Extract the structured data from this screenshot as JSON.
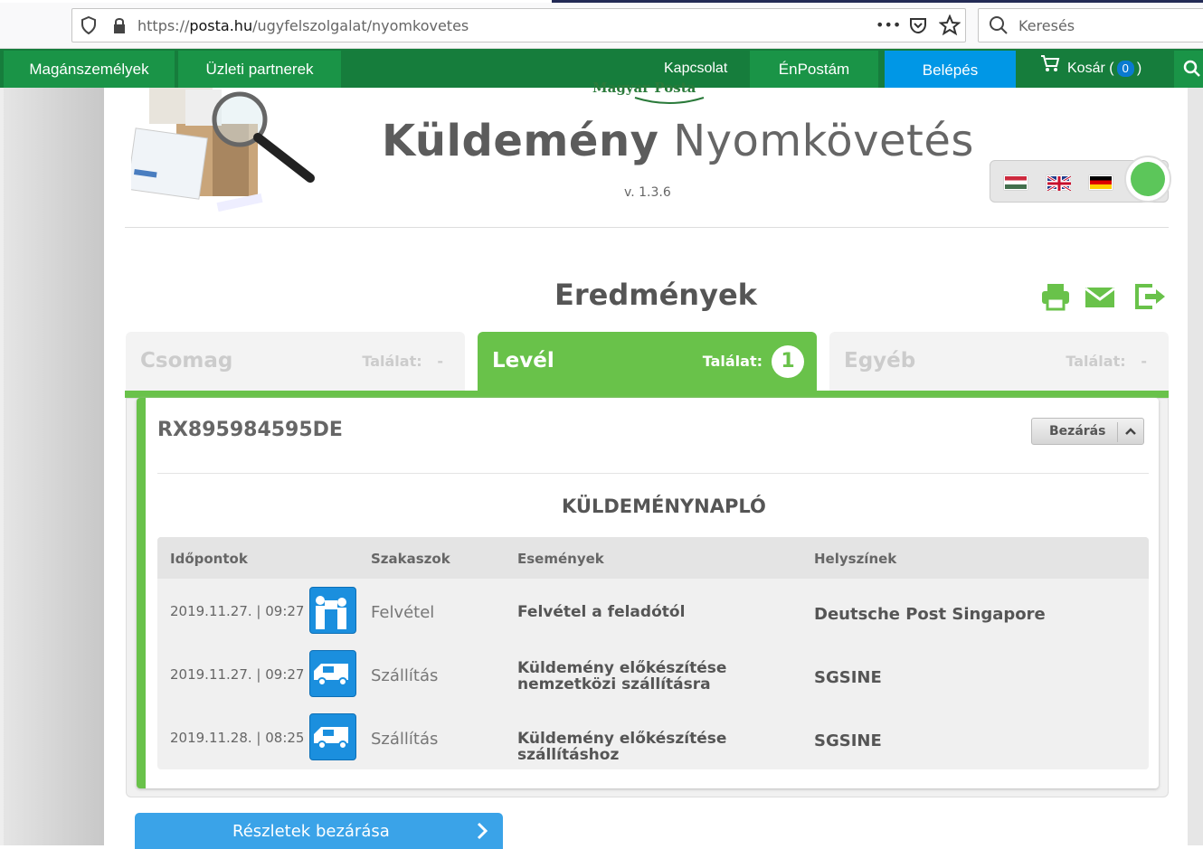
{
  "browser": {
    "url_prefix": "https://",
    "url_domain": "posta.hu",
    "url_path": "/ugyfelszolgalat/nyomkovetes",
    "menu_dots": "•••",
    "search_placeholder": "Keresés"
  },
  "nav": {
    "items": [
      "Magánszemélyek",
      "Üzleti partnerek"
    ],
    "contact": "Kapcsolat",
    "enpostam": "ÉnPostám",
    "login": "Belépés",
    "cart_label": "Kosár",
    "cart_open": "(",
    "cart_count": "0",
    "cart_close": ")"
  },
  "header": {
    "logo_text": "Magyar Posta",
    "title_bold": "Küldemény",
    "title_light": "Nyomkövetés",
    "version": "v. 1.3.6"
  },
  "languages": [
    "hu",
    "en",
    "de",
    "globe"
  ],
  "results": {
    "heading": "Eredmények",
    "action_icons": [
      "print-icon",
      "mail-icon",
      "export-icon"
    ],
    "tabs": [
      {
        "name": "Csomag",
        "label": "Találat:",
        "count": "-"
      },
      {
        "name": "Levél",
        "label": "Találat:",
        "count": "1"
      },
      {
        "name": "Egyéb",
        "label": "Találat:",
        "count": "-"
      }
    ]
  },
  "shipment": {
    "tracking_number": "RX895984595DE",
    "close_label": "Bezárás",
    "log_title": "KÜLDEMÉNYNAPLÓ",
    "columns": [
      "Időpontok",
      "Szakaszok",
      "Események",
      "Helyszínek"
    ],
    "rows": [
      {
        "date": "2019.11.27. | 09:27",
        "icon": "handover-icon",
        "phase": "Felvétel",
        "event": "Felvétel a feladótól",
        "location": "Deutsche Post Singapore"
      },
      {
        "date": "2019.11.27. | 09:27",
        "icon": "van-icon",
        "phase": "Szállítás",
        "event": "Küldemény előkészítése nemzetközi szállításra",
        "location": "SGSINE"
      },
      {
        "date": "2019.11.28. | 08:25",
        "icon": "van-icon",
        "phase": "Szállítás",
        "event": "Küldemény előkészítése szállításhoz",
        "location": "SGSINE"
      }
    ]
  },
  "footer_button": "Részletek bezárása",
  "colors": {
    "brand_green": "#167d3c",
    "accent_green": "#69c24a",
    "blue": "#0097e6"
  }
}
